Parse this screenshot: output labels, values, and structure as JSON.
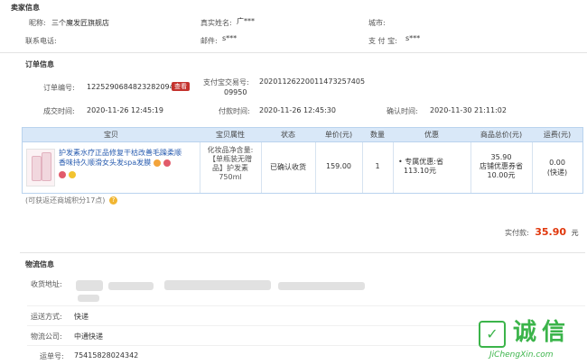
{
  "seller": {
    "title": "卖家信息",
    "nickname_label": "昵称:",
    "nickname_value": "三个魔发匠旗舰店",
    "realname_label": "真实姓名:",
    "realname_value": "广***",
    "city_label": "城市:",
    "contact_label": "联系电话:",
    "email_label": "邮件:",
    "email_value": "s***",
    "alipay_label": "支 付 宝:",
    "alipay_value": "s***"
  },
  "order": {
    "title": "订单信息",
    "order_no_label": "订单编号:",
    "order_no_value": "1225290684823282094",
    "quick_button": "查看",
    "alipay_trade_label": "支付宝交易号:",
    "alipay_trade_line1": "2020112622001147325740​5",
    "alipay_trade_line2": "09950",
    "deal_time_label": "成交时间:",
    "deal_time_value": "2020-11-26 12:45:19",
    "pay_time_label": "付款时间:",
    "pay_time_value": "2020-11-26 12:45:30",
    "confirm_time_label": "确认时间:",
    "confirm_time_value": "2020-11-30 21:11:02"
  },
  "table": {
    "headers": [
      "宝贝",
      "宝贝属性",
      "状态",
      "单价(元)",
      "数量",
      "优惠",
      "商品总价(元)",
      "运费(元)"
    ],
    "item": {
      "title_line1": "护发素水疗正品修复干枯改善毛躁柔顺",
      "title_line2": "香味持久顺滑女头发spa发膜",
      "attr_line1": "化妆品净含量:",
      "attr_line2": "【单瓶装无赠",
      "attr_line3": "品】护发素",
      "attr_line4": "750ml",
      "status": "已确认收货",
      "unit_price": "159.00",
      "quantity": "1",
      "discount_line1": "• 专属优惠:省",
      "discount_line2": "113.10元",
      "total_line1": "35.90",
      "total_line2": "店铺优惠券省",
      "total_line3": "10.00元",
      "shipping_line1": "0.00",
      "shipping_line2": "(快递)"
    }
  },
  "points_note": "(可获返还商城积分17点)",
  "paid": {
    "label": "实付款:",
    "amount": "35.90",
    "unit": "元"
  },
  "logistics": {
    "title": "物流信息",
    "address_label": "收货地址:",
    "method_label": "运送方式:",
    "method_value": "快递",
    "company_label": "物流公司:",
    "company_value": "中通快递",
    "tracking_label": "运单号:",
    "tracking_value": "75415828024342"
  },
  "watermark": {
    "text": "诚信",
    "url": "JiChengXin.com"
  },
  "colors": {
    "accent": "#e0360b",
    "link": "#2a5db0",
    "table_header": "#d9e8f8",
    "quick_button": "#c4322d",
    "watermark": "#3bb44a"
  }
}
